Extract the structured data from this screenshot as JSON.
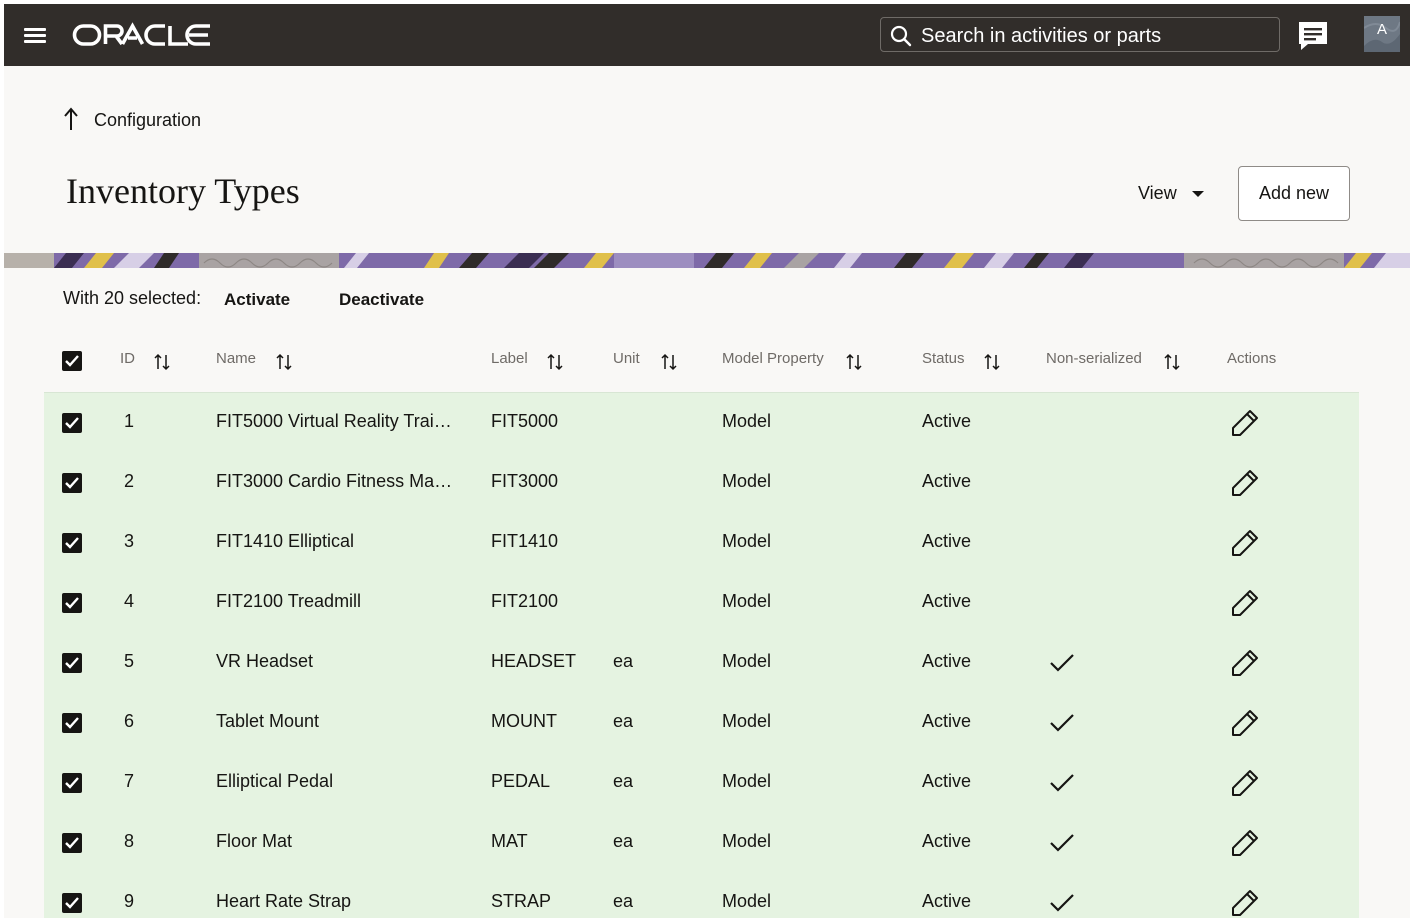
{
  "header": {
    "logo_text": "ORACLE",
    "search_placeholder": "Search in activities or parts",
    "avatar_initial": "A",
    "colors": {
      "bar": "#312d2a",
      "text": "#ffffff"
    }
  },
  "breadcrumb": {
    "label": "Configuration",
    "icon": "arrow-up-icon"
  },
  "page": {
    "title": "Inventory Types",
    "view_label": "View",
    "add_label": "Add new"
  },
  "selection": {
    "info": "With 20 selected:",
    "actions": [
      "Activate",
      "Deactivate"
    ]
  },
  "table": {
    "columns": [
      "ID",
      "Name",
      "Label",
      "Unit",
      "Model Property",
      "Status",
      "Non-serialized",
      "Actions"
    ],
    "rows": [
      {
        "id": "1",
        "name": "FIT5000 Virtual Reality Trai…",
        "label": "FIT5000",
        "unit": "",
        "model": "Model",
        "status": "Active",
        "non_serialized": false,
        "selected": true
      },
      {
        "id": "2",
        "name": "FIT3000 Cardio Fitness Ma…",
        "label": "FIT3000",
        "unit": "",
        "model": "Model",
        "status": "Active",
        "non_serialized": false,
        "selected": true
      },
      {
        "id": "3",
        "name": "FIT1410 Elliptical",
        "label": "FIT1410",
        "unit": "",
        "model": "Model",
        "status": "Active",
        "non_serialized": false,
        "selected": true
      },
      {
        "id": "4",
        "name": "FIT2100 Treadmill",
        "label": "FIT2100",
        "unit": "",
        "model": "Model",
        "status": "Active",
        "non_serialized": false,
        "selected": true
      },
      {
        "id": "5",
        "name": "VR Headset",
        "label": "HEADSET",
        "unit": "ea",
        "model": "Model",
        "status": "Active",
        "non_serialized": true,
        "selected": true
      },
      {
        "id": "6",
        "name": "Tablet Mount",
        "label": "MOUNT",
        "unit": "ea",
        "model": "Model",
        "status": "Active",
        "non_serialized": true,
        "selected": true
      },
      {
        "id": "7",
        "name": "Elliptical Pedal",
        "label": "PEDAL",
        "unit": "ea",
        "model": "Model",
        "status": "Active",
        "non_serialized": true,
        "selected": true
      },
      {
        "id": "8",
        "name": "Floor Mat",
        "label": "MAT",
        "unit": "ea",
        "model": "Model",
        "status": "Active",
        "non_serialized": true,
        "selected": true
      },
      {
        "id": "9",
        "name": "Heart Rate Strap",
        "label": "STRAP",
        "unit": "ea",
        "model": "Model",
        "status": "Active",
        "non_serialized": true,
        "selected": true
      }
    ],
    "colors": {
      "selected_row": "#e5f3e1",
      "header_text": "#6f6b67"
    }
  }
}
